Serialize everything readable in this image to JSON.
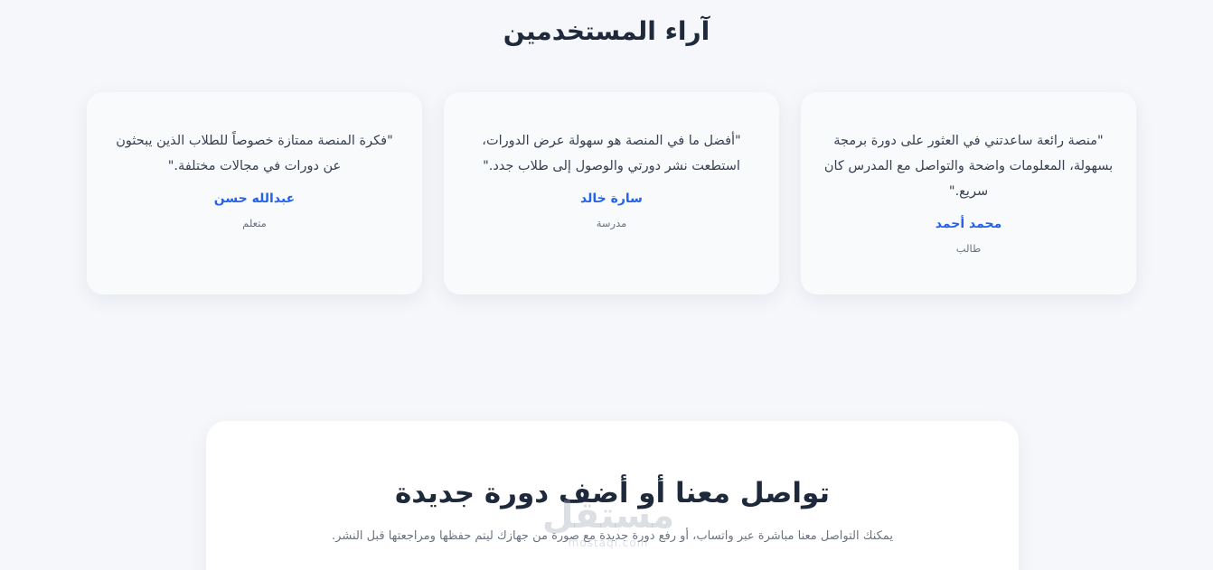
{
  "testimonials": {
    "title": "آراء المستخدمين",
    "items": [
      {
        "quote": "\"منصة رائعة ساعدتني في العثور على دورة برمجة بسهولة، المعلومات واضحة والتواصل مع المدرس كان سريع.\"",
        "name": "محمد أحمد",
        "role": "طالب"
      },
      {
        "quote": "\"أفضل ما في المنصة هو سهولة عرض الدورات، استطعت نشر دورتي والوصول إلى طلاب جدد.\"",
        "name": "سارة خالد",
        "role": "مدرسة"
      },
      {
        "quote": "\"فكرة المنصة ممتازة خصوصاً للطلاب الذين يبحثون عن دورات في مجالات مختلفة.\"",
        "name": "عبدالله حسن",
        "role": "متعلم"
      }
    ]
  },
  "contact": {
    "title": "تواصل معنا أو أضف دورة جديدة",
    "description": "يمكنك التواصل معنا مباشرة عبر واتساب، أو رفع دورة جديدة مع صورة من جهازك ليتم حفظها ومراجعتها قبل النشر."
  },
  "watermark": {
    "main": "مستقل",
    "sub": "mostaql.com"
  }
}
